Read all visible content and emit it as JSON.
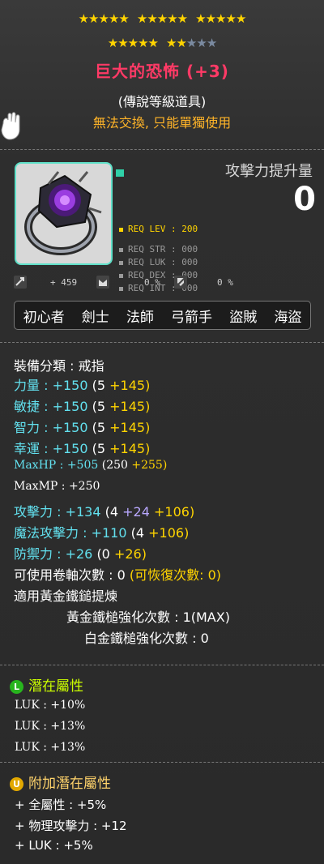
{
  "header": {
    "stars_top_groups": [
      5,
      5,
      5
    ],
    "stars_second_full": 7,
    "stars_second_total": 10,
    "title": "巨大的恐怖 (+3)",
    "grade": "(傳說等級道具)",
    "trade_note": "無法交換, 只能單獨使用"
  },
  "summary": {
    "atk_increase_label": "攻擊力提升量",
    "atk_increase_value": "0",
    "req_lev": "REQ LEV : 200",
    "req_str": "REQ STR : 000",
    "req_luk": "REQ LUK : 000",
    "req_dex": "REQ DEX : 000",
    "req_int": "REQ INT : 000",
    "stat_a": "+ 459",
    "stat_b": "0 %",
    "stat_c": "0 %"
  },
  "jobs": [
    "初心者",
    "劍士",
    "法師",
    "弓箭手",
    "盜賊",
    "海盜"
  ],
  "stats": {
    "category": "裝備分類 : 戒指",
    "str": {
      "label": "力量 :",
      "total": "+150",
      "base": "(5",
      "bonus": "+145)"
    },
    "dex": {
      "label": "敏捷 :",
      "total": "+150",
      "base": "(5",
      "bonus": "+145)"
    },
    "int": {
      "label": "智力 :",
      "total": "+150",
      "base": "(5",
      "bonus": "+145)"
    },
    "luk": {
      "label": "幸運 :",
      "total": "+150",
      "base": "(5",
      "bonus": "+145)"
    },
    "maxhp": {
      "label": "MaxHP :",
      "total": "+505",
      "base": "(250",
      "bonus": "+255)"
    },
    "maxmp": {
      "label": "MaxMP :",
      "total": "+250"
    },
    "atk": {
      "label": "攻擊力 :",
      "total": "+134",
      "base": "(4",
      "extra": "+24",
      "bonus": "+106)"
    },
    "matk": {
      "label": "魔法攻擊力 :",
      "total": "+110",
      "base": "(4",
      "bonus": "+106)"
    },
    "def": {
      "label": "防禦力 :",
      "total": "+26",
      "base": "(0",
      "bonus": "+26)"
    },
    "scrolls": "可使用卷軸次數 : 0",
    "scrolls_recover": "(可恢復次數: 0)",
    "hammer": "適用黃金鐵鎚提煉",
    "gold_hammer": "黃金鐵槌強化次數 : 1(MAX)",
    "platinum_hammer": "白金鐵槌強化次數 : 0"
  },
  "potential": {
    "badge": "L",
    "title": "潛在屬性",
    "lines": [
      "LUK : +10%",
      "LUK : +13%",
      "LUK : +13%"
    ]
  },
  "bonus_potential": {
    "badge": "U",
    "title": "附加潛在屬性",
    "lines": [
      "+ 全屬性 : +5%",
      "+ 物理攻擊力 : +12",
      "+ LUK : +5%"
    ]
  },
  "colors": {
    "title": "#ff3a66",
    "trade_note": "#ffb428",
    "stat_cyan": "#62e0ee",
    "bonus_yellow": "#ffd400",
    "potential_head": "#ccff00",
    "bonus_potential_head": "#ffd36b"
  }
}
